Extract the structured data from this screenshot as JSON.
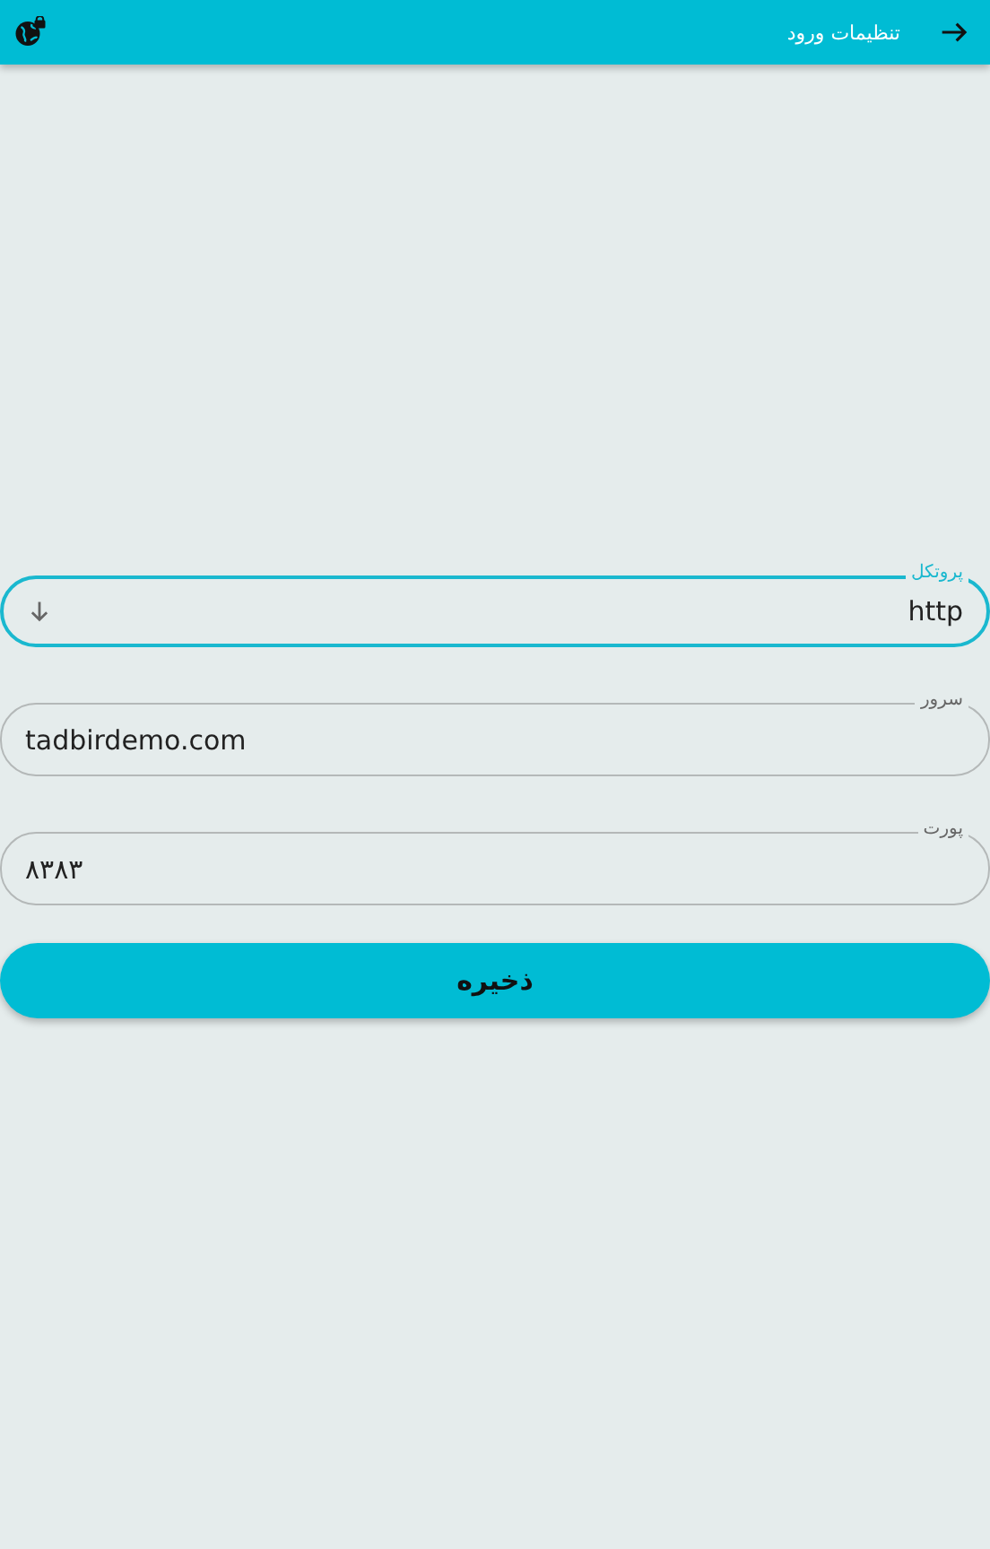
{
  "app_bar": {
    "title": "تنظیمات ورود"
  },
  "fields": [
    {
      "kind": "select",
      "label": "پروتکل",
      "value": "http",
      "focused": true
    },
    {
      "kind": "text",
      "label": "سرور",
      "value": "tadbirdemo.com",
      "focused": false
    },
    {
      "kind": "text",
      "label": "پورت",
      "value": "۸۳۸۳",
      "focused": false
    }
  ],
  "save_button": "ذخیره"
}
